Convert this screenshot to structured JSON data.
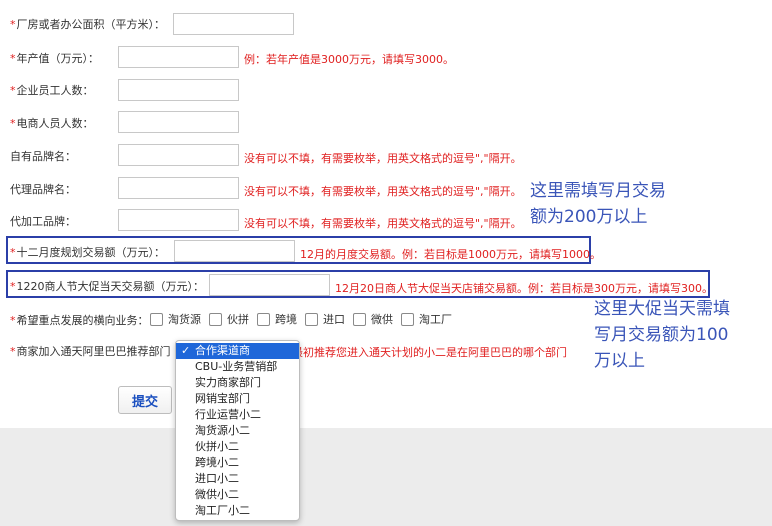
{
  "form": {
    "area": {
      "label": "厂房或者办公面积（平方米）：",
      "required": true,
      "hint": ""
    },
    "annual_output": {
      "label": "年产值（万元）：",
      "required": true,
      "hint": "例：若年产值是3000万元，请填写3000。"
    },
    "employees": {
      "label": "企业员工人数：",
      "required": true,
      "hint": ""
    },
    "ecom_staff": {
      "label": "电商人员人数：",
      "required": true,
      "hint": ""
    },
    "own_brand": {
      "label": "自有品牌名：",
      "required": false,
      "hint": "没有可以不填，有需要枚举，用英文格式的逗号\",\"隔开。"
    },
    "agent_brand": {
      "label": "代理品牌名：",
      "required": false,
      "hint": "没有可以不填，有需要枚举，用英文格式的逗号\",\"隔开。"
    },
    "oem_brand": {
      "label": "代加工品牌：",
      "required": false,
      "hint": "没有可以不填，有需要枚举，用英文格式的逗号\",\"隔开。"
    },
    "dec_plan": {
      "label": "十二月度规划交易额（万元）：",
      "required": true,
      "hint": "12月的月度交易额。例：若目标是1000万元，请填写1000。"
    },
    "day1220": {
      "label": "1220商人节大促当天交易额（万元）：",
      "required": true,
      "hint": "12月20日商人节大促当天店铺交易额。例：若目标是300万元，请填写300。"
    },
    "business_focus": {
      "label": "希望重点发展的横向业务：",
      "required": true,
      "options": [
        "淘货源",
        "伙拼",
        "跨境",
        "进口",
        "微供",
        "淘工厂"
      ]
    },
    "referral": {
      "label": "商家加入通天阿里巴巴推荐部门",
      "required": true,
      "hint_tail": "最初推荐您进入通天计划的小二是在阿里巴巴的哪个部门"
    },
    "submit_label": "提交"
  },
  "dropdown": {
    "check": "✓",
    "options": [
      "合作渠道商",
      "CBU-业务营销部",
      "实力商家部门",
      "网销宝部门",
      "行业运营小二",
      "淘货源小二",
      "伙拼小二",
      "跨境小二",
      "进口小二",
      "微供小二",
      "淘工厂小二"
    ],
    "selected_index": 0
  },
  "annotations": {
    "note1_line1": "这里需填写月交易",
    "note1_line2": "额为200万以上",
    "note2_line1": "这里大促当天需填",
    "note2_line2": "写月交易额为100",
    "note2_line3": "万以上"
  },
  "colors": {
    "required_star": "#e02020",
    "hint_text": "#e02020",
    "highlight_box": "#2b3fa8",
    "annotation_text": "#3a55b8",
    "dropdown_selected": "#1f67d9",
    "submit_text": "#1a4fbf"
  }
}
